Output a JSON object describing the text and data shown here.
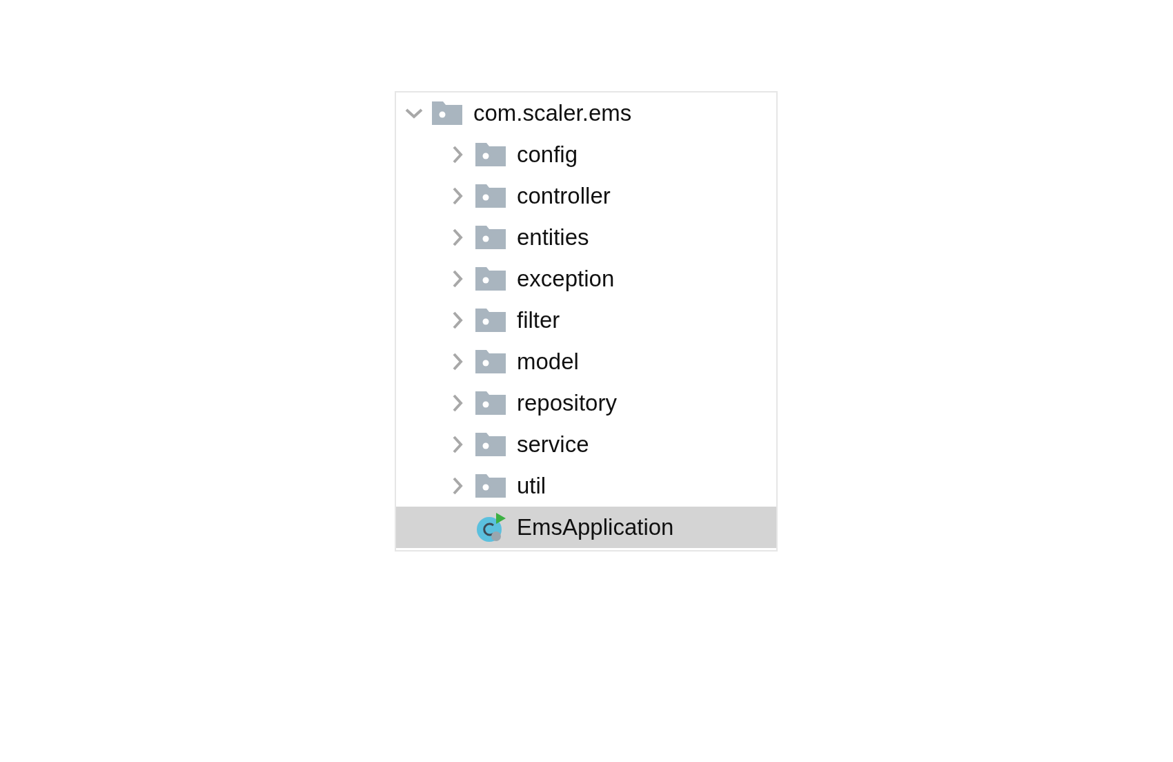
{
  "tree": [
    {
      "kind": "package",
      "label": "com.scaler.ems",
      "expanded": true,
      "selected": false,
      "children": [
        {
          "kind": "package",
          "label": "config",
          "expanded": false,
          "selected": false
        },
        {
          "kind": "package",
          "label": "controller",
          "expanded": false,
          "selected": false
        },
        {
          "kind": "package",
          "label": "entities",
          "expanded": false,
          "selected": false
        },
        {
          "kind": "package",
          "label": "exception",
          "expanded": false,
          "selected": false
        },
        {
          "kind": "package",
          "label": "filter",
          "expanded": false,
          "selected": false
        },
        {
          "kind": "package",
          "label": "model",
          "expanded": false,
          "selected": false
        },
        {
          "kind": "package",
          "label": "repository",
          "expanded": false,
          "selected": false
        },
        {
          "kind": "package",
          "label": "service",
          "expanded": false,
          "selected": false
        },
        {
          "kind": "package",
          "label": "util",
          "expanded": false,
          "selected": false
        },
        {
          "kind": "class",
          "label": "EmsApplication",
          "selected": true
        }
      ]
    }
  ]
}
